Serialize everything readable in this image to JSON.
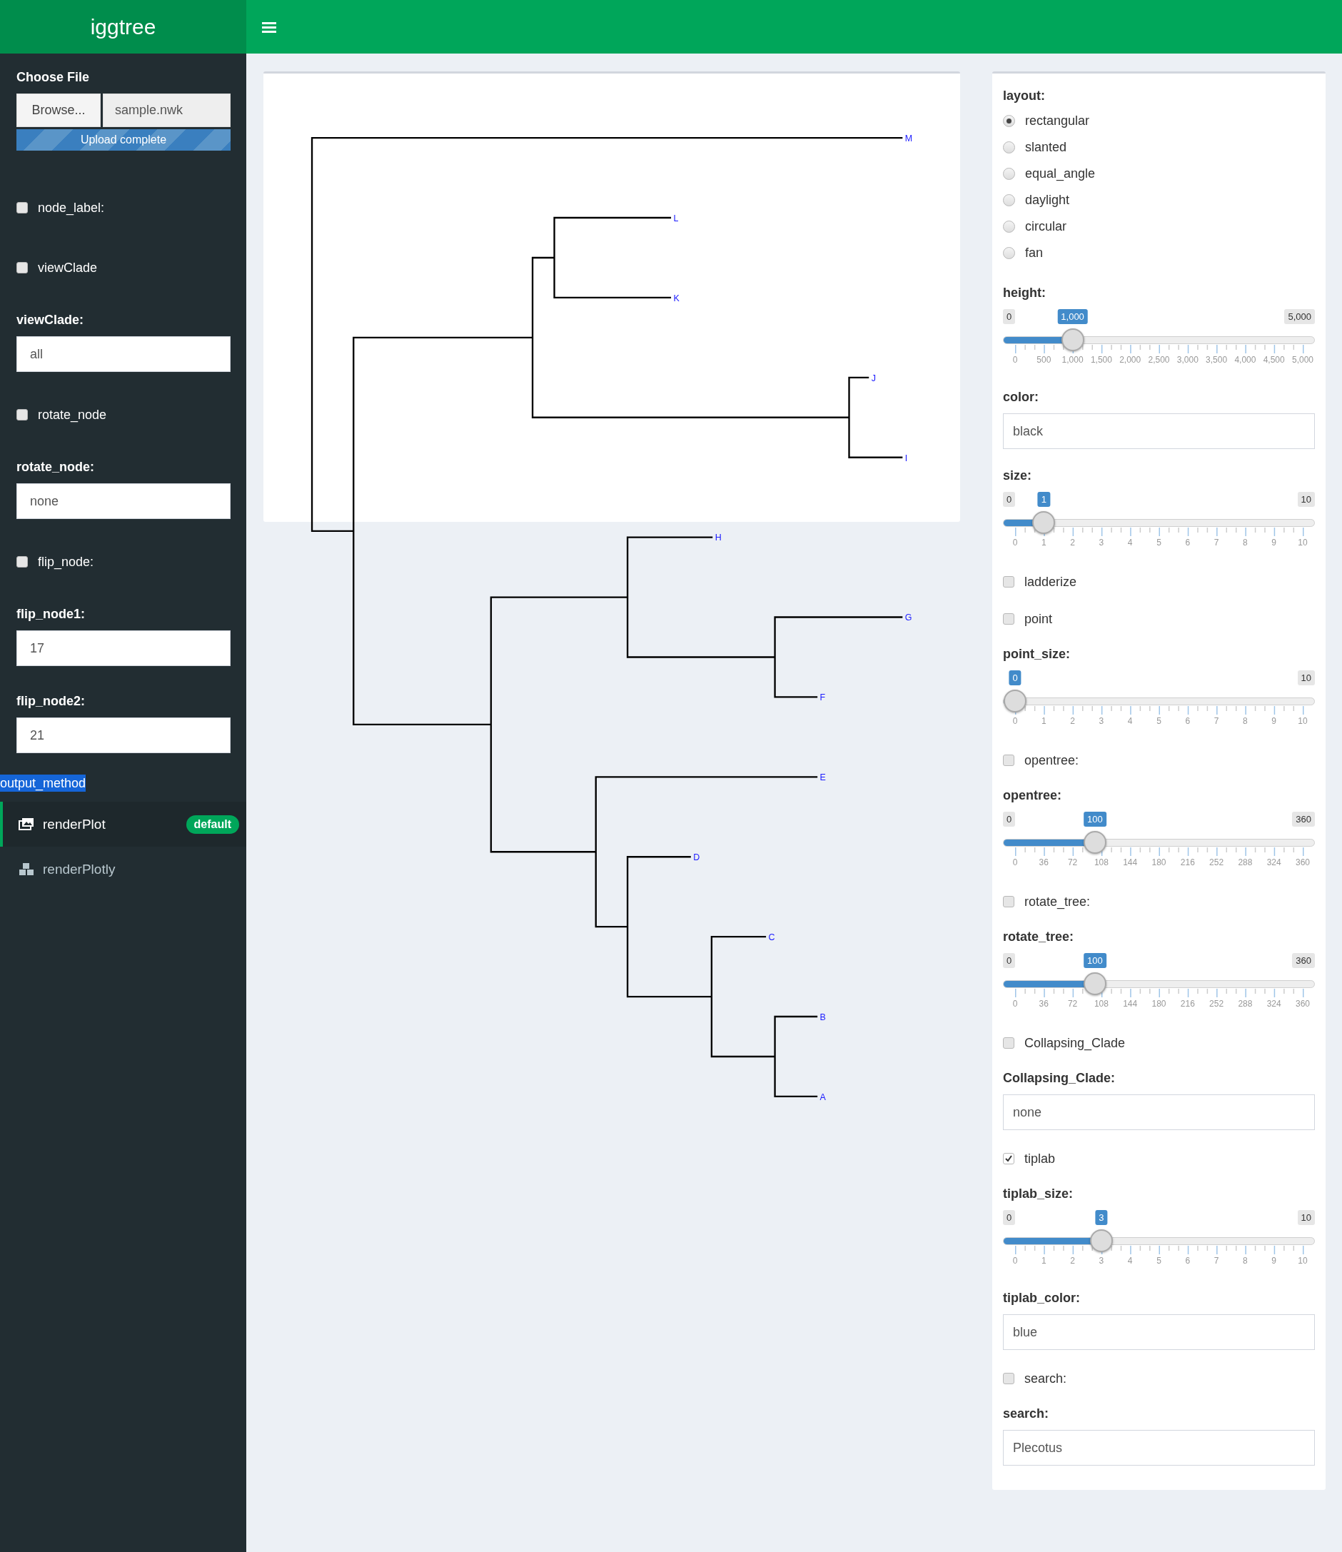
{
  "header": {
    "title": "iggtree"
  },
  "sidebar": {
    "file_input": {
      "label": "Choose File",
      "button": "Browse...",
      "filename": "sample.nwk",
      "progress": "Upload complete",
      "level": 1
    },
    "controls": [
      {
        "kind": "checkbox",
        "label": "node_label:",
        "checked": false
      },
      {
        "kind": "checkbox",
        "label": "viewClade",
        "checked": false
      },
      {
        "kind": "text",
        "label": "viewClade:",
        "value": "all"
      },
      {
        "kind": "checkbox",
        "label": "rotate_node",
        "checked": false
      },
      {
        "kind": "text",
        "label": "rotate_node:",
        "value": "none"
      },
      {
        "kind": "checkbox",
        "label": "flip_node:",
        "checked": false
      },
      {
        "kind": "text",
        "label": "flip_node1:",
        "value": "17"
      },
      {
        "kind": "text",
        "label": "flip_node2:",
        "value": "21"
      }
    ],
    "section_header": "output_method",
    "menu": [
      {
        "label": "renderPlot",
        "badge": "default",
        "selected": true
      },
      {
        "label": "renderPlotly",
        "selected": false
      }
    ]
  },
  "plot": {
    "tree": {
      "children": [
        {
          "label": "M"
        },
        {
          "children": [
            {
              "children": [
                {
                  "children": [
                    {
                      "label": "L"
                    },
                    {
                      "label": "K"
                    }
                  ]
                },
                {
                  "children": [
                    {
                      "label": "J"
                    },
                    {
                      "label": "I"
                    }
                  ]
                }
              ]
            },
            {
              "children": [
                {
                  "children": [
                    {
                      "label": "H"
                    },
                    {
                      "children": [
                        {
                          "label": "G"
                        },
                        {
                          "label": "F"
                        }
                      ]
                    }
                  ]
                },
                {
                  "children": [
                    {
                      "label": "E"
                    },
                    {
                      "children": [
                        {
                          "label": "D"
                        },
                        {
                          "children": [
                            {
                              "label": "C"
                            },
                            {
                              "children": [
                                {
                                  "label": "B"
                                },
                                {
                                  "label": "A"
                                }
                              ]
                            }
                          ]
                        }
                      ]
                    }
                  ]
                }
              ]
            }
          ]
        }
      ]
    }
  },
  "panel": {
    "controls": [
      {
        "kind": "radio",
        "label": "layout:",
        "options": [
          {
            "label": "rectangular",
            "selected": true
          },
          {
            "label": "slanted",
            "selected": false
          },
          {
            "label": "equal_angle",
            "selected": false
          },
          {
            "label": "daylight",
            "selected": false
          },
          {
            "label": "circular",
            "selected": false
          },
          {
            "label": "fan",
            "selected": false
          }
        ]
      },
      {
        "kind": "slider",
        "label": "height:",
        "min": "0",
        "max": "5,000",
        "value": "1,000",
        "level": 0.2,
        "ticks": [
          "0",
          "500",
          "1,000",
          "1,500",
          "2,000",
          "2,500",
          "3,000",
          "3,500",
          "4,000",
          "4,500",
          "5,000"
        ]
      },
      {
        "kind": "text",
        "label": "color:",
        "value": "black"
      },
      {
        "kind": "slider",
        "label": "size:",
        "min": "0",
        "max": "10",
        "value": "1",
        "level": 0.1,
        "ticks": [
          "0",
          "1",
          "2",
          "3",
          "4",
          "5",
          "6",
          "7",
          "8",
          "9",
          "10"
        ]
      },
      {
        "kind": "checkbox",
        "label": "ladderize",
        "checked": false
      },
      {
        "kind": "checkbox",
        "label": "point",
        "checked": false
      },
      {
        "kind": "slider",
        "label": "point_size:",
        "max": "10",
        "value": "0",
        "level": 0,
        "ticks": [
          "0",
          "1",
          "2",
          "3",
          "4",
          "5",
          "6",
          "7",
          "8",
          "9",
          "10"
        ]
      },
      {
        "kind": "checkbox",
        "label": "opentree:",
        "checked": false
      },
      {
        "kind": "slider",
        "label": "opentree:",
        "min": "0",
        "max": "360",
        "value": "100",
        "level": 0.2778,
        "ticks": [
          "0",
          "36",
          "72",
          "108",
          "144",
          "180",
          "216",
          "252",
          "288",
          "324",
          "360"
        ]
      },
      {
        "kind": "checkbox",
        "label": "rotate_tree:",
        "checked": false
      },
      {
        "kind": "slider",
        "label": "rotate_tree:",
        "min": "0",
        "max": "360",
        "value": "100",
        "level": 0.2778,
        "ticks": [
          "0",
          "36",
          "72",
          "108",
          "144",
          "180",
          "216",
          "252",
          "288",
          "324",
          "360"
        ]
      },
      {
        "kind": "checkbox",
        "label": "Collapsing_Clade",
        "checked": false
      },
      {
        "kind": "text",
        "label": "Collapsing_Clade:",
        "value": "none"
      },
      {
        "kind": "checkbox",
        "label": "tiplab",
        "checked": true
      },
      {
        "kind": "slider",
        "label": "tiplab_size:",
        "min": "0",
        "max": "10",
        "value": "3",
        "level": 0.3,
        "ticks": [
          "0",
          "1",
          "2",
          "3",
          "4",
          "5",
          "6",
          "7",
          "8",
          "9",
          "10"
        ]
      },
      {
        "kind": "text",
        "label": "tiplab_color:",
        "value": "blue"
      },
      {
        "kind": "checkbox",
        "label": "search:",
        "checked": false
      },
      {
        "kind": "text",
        "label": "search:",
        "value": "Plecotus"
      }
    ]
  }
}
